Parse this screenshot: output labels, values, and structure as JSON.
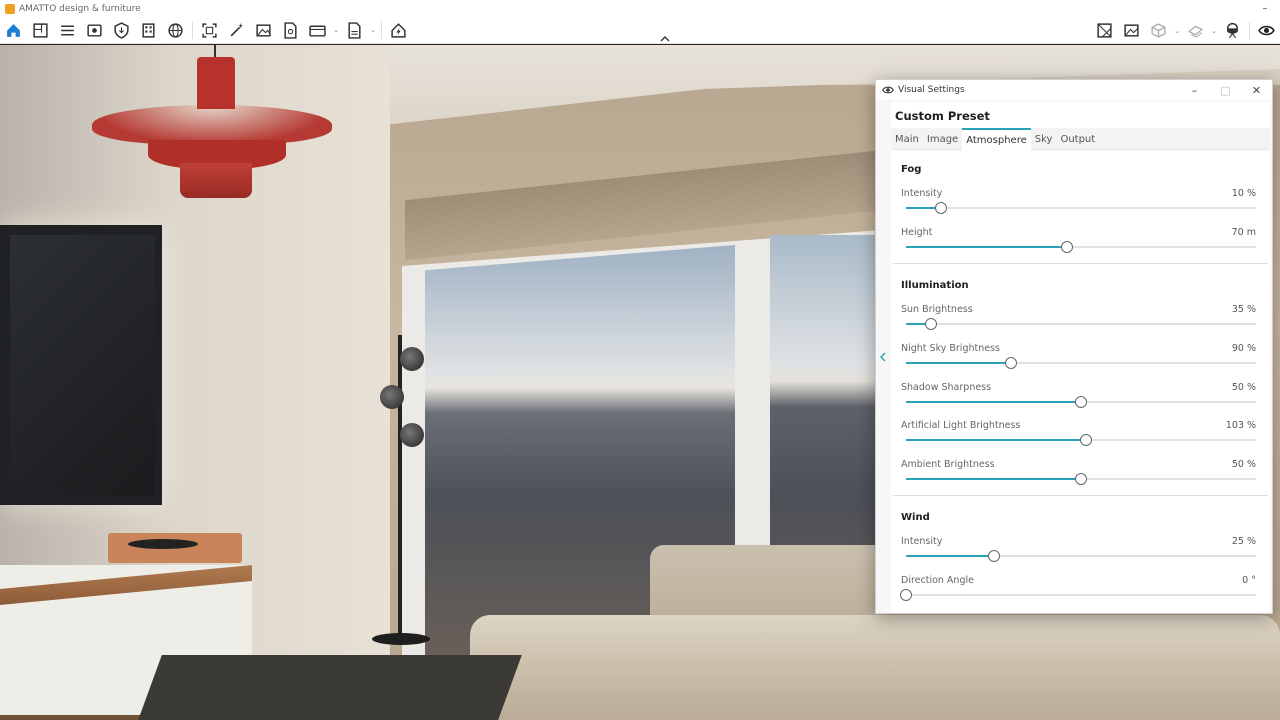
{
  "app": {
    "title": "AMATTO design & furniture"
  },
  "colors": {
    "accent": "#2aa3b8",
    "toolbar_active": "#1a7fd4"
  },
  "toolbar": {
    "left_icons": [
      "home-icon",
      "floorplan-icon",
      "list-icon",
      "view-3d-icon",
      "shield-export-icon",
      "building-icon",
      "render-globe-icon",
      "frame-icon",
      "magic-wand-icon",
      "image-icon",
      "file-settings-icon",
      "video-icon",
      "document-icon",
      "lightning-icon"
    ],
    "right_icons": [
      "floorplan-map-icon",
      "photo-icon",
      "cube-icon",
      "layers-icon",
      "vr-headset-icon",
      "eye-icon"
    ]
  },
  "panel": {
    "title": "Visual Settings",
    "preset": "Custom Preset",
    "tabs": [
      "Main",
      "Image",
      "Atmosphere",
      "Sky",
      "Output"
    ],
    "active_tab": "Atmosphere",
    "sections": {
      "fog": {
        "title": "Fog",
        "intensity": {
          "label": "Intensity",
          "value": "10 %",
          "level": 0.1
        },
        "height": {
          "label": "Height",
          "value": "70 m",
          "level": 0.46
        }
      },
      "illumination": {
        "title": "Illumination",
        "sun": {
          "label": "Sun Brightness",
          "value": "35 %",
          "level": 0.07
        },
        "night_sky": {
          "label": "Night Sky Brightness",
          "value": "90 %",
          "level": 0.3
        },
        "shadow": {
          "label": "Shadow Sharpness",
          "value": "50 %",
          "level": 0.5
        },
        "artificial": {
          "label": "Artificial Light Brightness",
          "value": "103 %",
          "level": 0.515
        },
        "ambient": {
          "label": "Ambient Brightness",
          "value": "50 %",
          "level": 0.5
        }
      },
      "wind": {
        "title": "Wind",
        "intensity": {
          "label": "Intensity",
          "value": "25 %",
          "level": 0.25
        },
        "direction": {
          "label": "Direction Angle",
          "value": "0 °",
          "level": 0
        }
      }
    }
  }
}
